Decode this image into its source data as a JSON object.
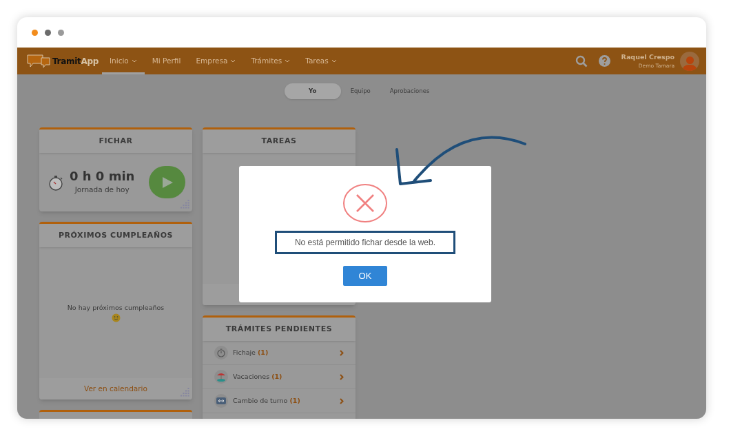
{
  "browser": {
    "dots": [
      {
        "color": "#f28c1c"
      },
      {
        "color": "#6b6b6b"
      },
      {
        "color": "#9a9a9a"
      }
    ]
  },
  "navbar": {
    "logo": [
      "Tramit",
      "App"
    ],
    "items": [
      {
        "label": "Inicio",
        "selected": true,
        "has_menu": true
      },
      {
        "label": "Mi Perfil",
        "selected": false,
        "has_menu": false
      },
      {
        "label": "Empresa",
        "selected": false,
        "has_menu": true
      },
      {
        "label": "Trámites",
        "selected": false,
        "has_menu": true
      },
      {
        "label": "Tareas",
        "selected": false,
        "has_menu": true
      }
    ],
    "user": {
      "name": "Raquel Crespo",
      "company": "Demo Tamara"
    }
  },
  "view_tabs": [
    {
      "label": "Yo",
      "selected": true
    },
    {
      "label": "Equipo",
      "selected": false
    },
    {
      "label": "Aprobaciones",
      "selected": false
    }
  ],
  "fichar": {
    "title": "FICHAR",
    "time": "0 h 0 min",
    "caption": "Jornada de hoy"
  },
  "birthdays": {
    "title": "PRÓXIMOS CUMPLEAÑOS",
    "empty": "No hay próximos cumpleaños",
    "footer_link": "Ver en calendario"
  },
  "tasks": {
    "title": "TAREAS"
  },
  "pending": {
    "title": "TRÁMITES PENDIENTES",
    "items": [
      {
        "kind": "clock",
        "label": "Fichaje",
        "count": "(1)"
      },
      {
        "kind": "beach",
        "label": "Vacaciones",
        "count": "(1)"
      },
      {
        "kind": "swap",
        "label": "Cambio de turno",
        "count": "(1)"
      }
    ]
  },
  "dialog": {
    "message": "No está permitido fichar desde la web.",
    "button": "OK"
  }
}
